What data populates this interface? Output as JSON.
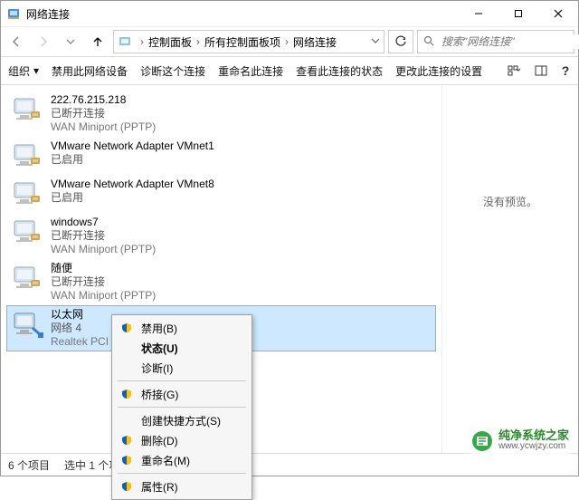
{
  "title": "网络连接",
  "breadcrumb": [
    "控制面板",
    "所有控制面板项",
    "网络连接"
  ],
  "search": {
    "placeholder": "搜索\"网络连接\""
  },
  "cmdbar": {
    "organize": "组织",
    "items": [
      "禁用此网络设备",
      "诊断这个连接",
      "重命名此连接",
      "查看此连接的状态",
      "更改此连接的设置"
    ]
  },
  "connections": [
    {
      "name": "222.76.215.218",
      "status": "已断开连接",
      "device": "WAN Miniport (PPTP)",
      "kind": "wan"
    },
    {
      "name": "VMware Network Adapter VMnet1",
      "status": "已启用",
      "device": "",
      "kind": "vm"
    },
    {
      "name": "VMware Network Adapter VMnet8",
      "status": "已启用",
      "device": "",
      "kind": "vm"
    },
    {
      "name": "windows7",
      "status": "已断开连接",
      "device": "WAN Miniport (PPTP)",
      "kind": "wan"
    },
    {
      "name": "随便",
      "status": "已断开连接",
      "device": "WAN Miniport (PPTP)",
      "kind": "wan"
    },
    {
      "name": "以太网",
      "status": "网络 4",
      "device": "Realtek PCI",
      "kind": "eth",
      "selected": true
    }
  ],
  "preview_text": "没有预览。",
  "context_menu": {
    "disable": "禁用(B)",
    "status": "状态(U)",
    "diagnose": "诊断(I)",
    "bridge": "桥接(G)",
    "shortcut": "创建快捷方式(S)",
    "delete": "删除(D)",
    "rename": "重命名(M)",
    "properties": "属性(R)"
  },
  "statusbar": {
    "count": "6 个项目",
    "selected": "选中 1 个项"
  },
  "watermark": {
    "cn": "纯净系统之家",
    "url": "www.ycwjzy.com"
  }
}
